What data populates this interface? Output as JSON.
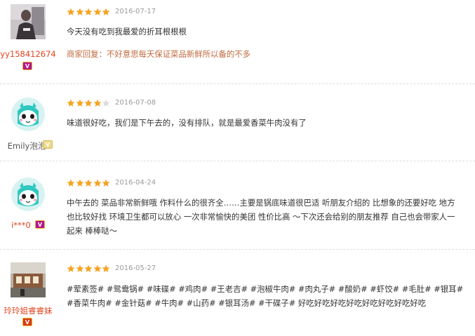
{
  "reviews": [
    {
      "username": "yy158412674",
      "username_color": "#e2451f",
      "avatar": "photo-avatar",
      "vip_level": "V",
      "vip_color": "#b5168e",
      "rating": 5,
      "date": "2016-07-17",
      "content": "今天没有吃到我最爱的折耳根根根",
      "reply": "商家回复：不好意思每天保证菜品新鲜所以备的不多"
    },
    {
      "username": "Emily泡泡",
      "username_color": "#555555",
      "avatar": "cartoon-avatar",
      "vip_level": "V",
      "vip_color": "#e5c46b",
      "rating": 4,
      "date": "2016-07-08",
      "content": "味道很好吃，我们是下午去的，没有排队，就是最爱香菜牛肉没有了"
    },
    {
      "username": "i***0",
      "username_color": "#e2451f",
      "avatar": "cartoon-avatar",
      "vip_level": "V",
      "vip_color": "#b5168e",
      "rating": 5,
      "date": "2016-04-24",
      "content": "中午去的 菜品非常新鲜哦 作料什么的很齐全……主要是锅底味道很巴适 听朋友介绍的 比想象的还要好吃 地方也比较好找 环境卫生都可以放心 一次非常愉快的美团 性价比高 ～下次还会给别的朋友推荐 自己也会带家人一起来 棒棒哒～"
    },
    {
      "username": "玲玲姐睿睿妹",
      "username_color": "#e2451f",
      "avatar": "photo-avatar",
      "vip_level": "V",
      "vip_color": "#d83a1c",
      "rating": 5,
      "date": "2016-05-27",
      "content": "#荤素签# #鸳鸯锅# #味碟# #鸡肉# #王老吉# #泡椒牛肉# #肉丸子# #酸奶# #虾饺# #毛肚# #银耳# #香菜牛肉# #金针菇# #牛肉# #山药# #银耳汤# #干碟子# 好吃好吃好吃好吃好吃好吃好吃好吃"
    }
  ],
  "colors": {
    "star_full": "#f6a321",
    "star_empty": "#dddddd",
    "reply": "#c06a3e",
    "divider": "#dddddd"
  }
}
